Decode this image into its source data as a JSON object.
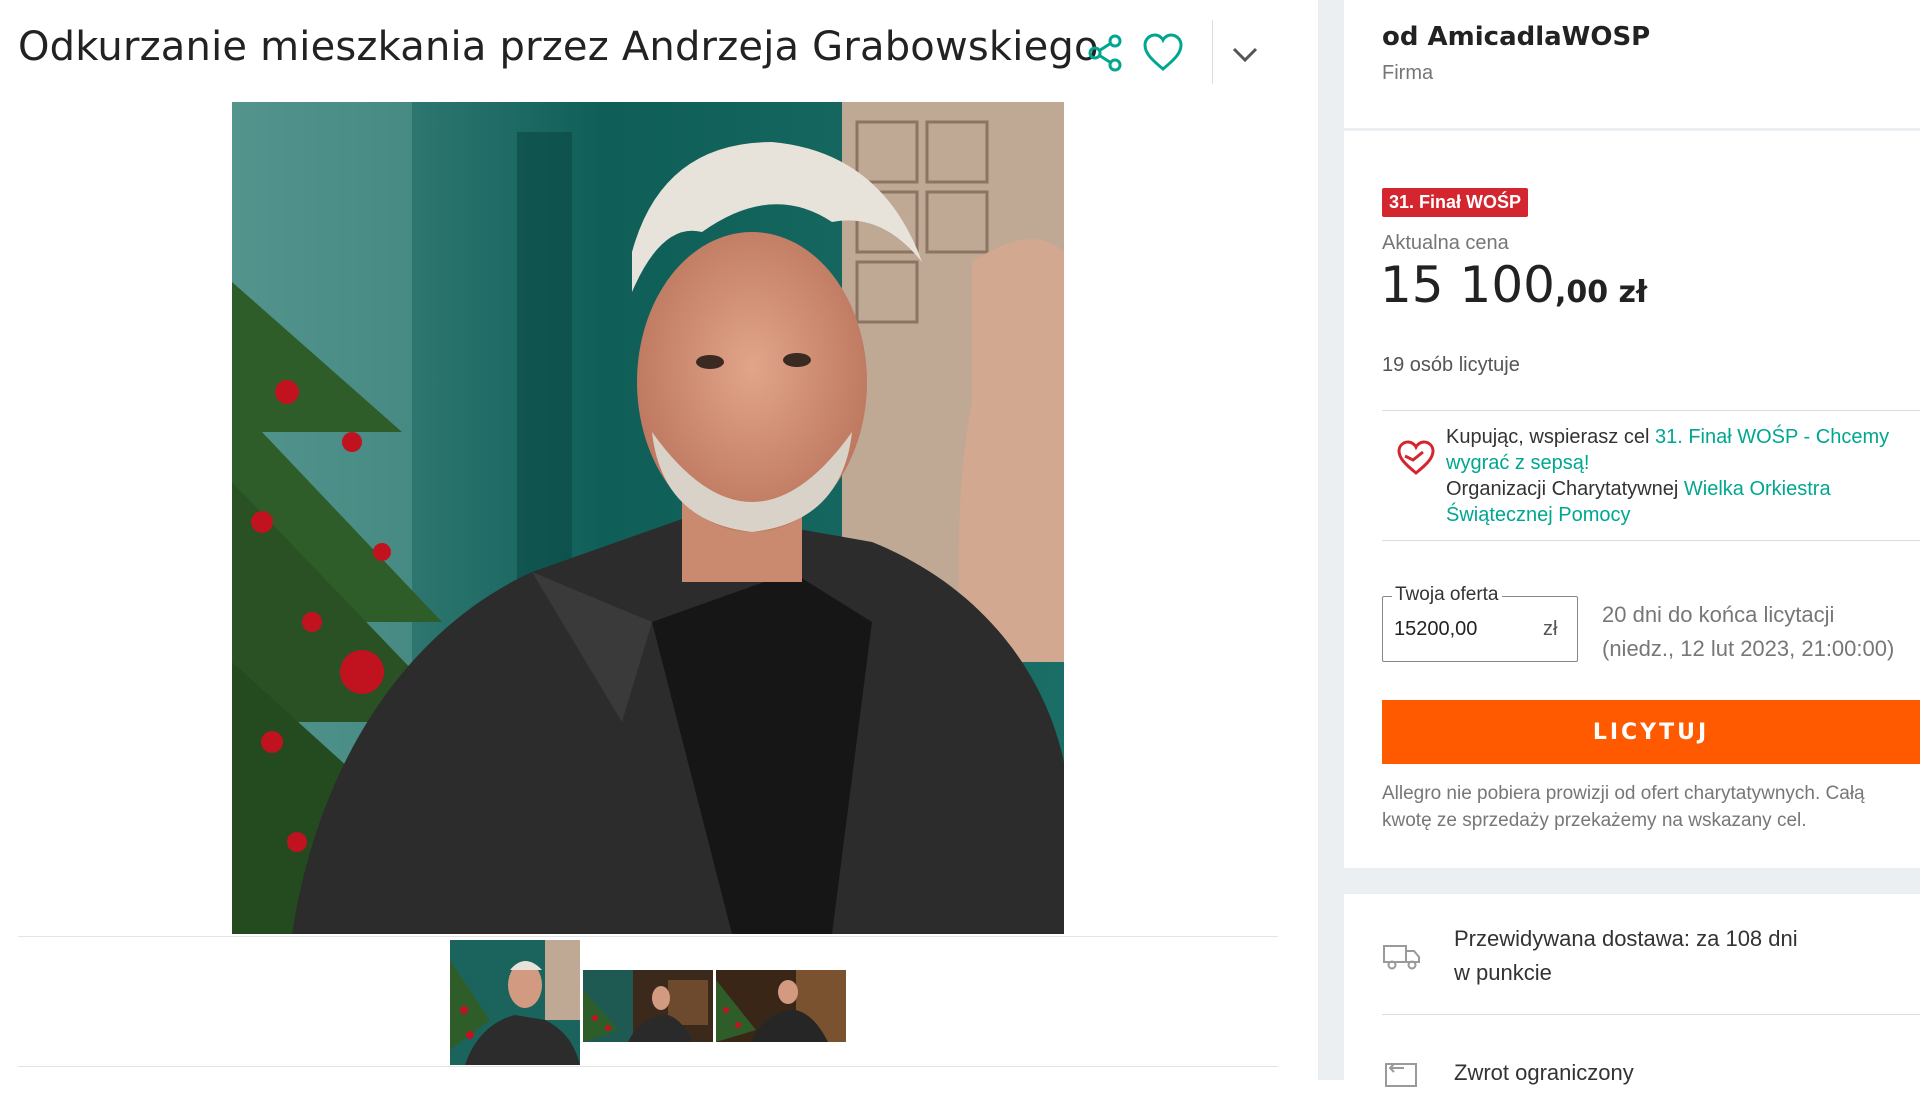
{
  "product": {
    "title": "Odkurzanie mieszkania przez Andrzeja Grabowskiego"
  },
  "icons": {
    "share": "share-icon",
    "favorite": "heart-icon",
    "more": "chevron-down-icon",
    "charity": "charity-heart-icon",
    "delivery": "truck-icon",
    "return": "return-icon"
  },
  "seller": {
    "name": "od AmicadlaWOSP",
    "type": "Firma"
  },
  "offer": {
    "badge": "31. Finał WOŚP",
    "price_label": "Aktualna cena",
    "price_main": "15 100",
    "price_fraction": ",00 zł",
    "bidders": "19 osób licytuje"
  },
  "charity": {
    "prefix": "Kupując, wspierasz cel ",
    "goal_link": "31. Finał WOŚP - Chcemy wygrać z sepsą!",
    "org_prefix": "Organizacji Charytatywnej ",
    "org_link": "Wielka Orkiestra Świątecznej Pomocy"
  },
  "bid_form": {
    "legend": "Twoja oferta",
    "value": "15200,00",
    "currency": "zł",
    "deadline_line1": "20 dni do końca licytacji",
    "deadline_line2": "(niedz., 12 lut 2023, 21:00:00)",
    "button": "LICYTUJ",
    "notice_line1": "Allegro nie pobiera prowizji od ofert charytatywnych. Całą",
    "notice_line2": "kwotę ze sprzedaży przekażemy na wskazany cel."
  },
  "delivery": {
    "line1": "Przewidywana dostawa: za 108 dni",
    "line2": "w punkcie",
    "return_text": "Zwrot ograniczony"
  },
  "colors": {
    "accent": "#00a790",
    "button": "#ff5a00",
    "badge": "#d4262f",
    "heart": "#d4262f"
  }
}
